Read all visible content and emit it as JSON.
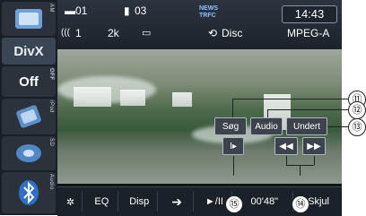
{
  "sidebar": {
    "sources": [
      {
        "label": "AM",
        "icon": "radio-icon"
      },
      {
        "label": "DivX",
        "icon": ""
      },
      {
        "label": "OFF",
        "text": "Off",
        "icon": ""
      },
      {
        "label": "iPod",
        "icon": "ipod-icon"
      },
      {
        "label": "SD",
        "icon": "sd-card-icon"
      },
      {
        "label": "Audio",
        "icon": "bluetooth-icon"
      }
    ]
  },
  "status": {
    "folder_number": "01",
    "file_number": "03",
    "channel": "1",
    "bitrate": "2k",
    "repeat_mode": "Disc",
    "format": "MPEG-A",
    "news_label": "NEWS",
    "traffic_label": "TRFC",
    "clock": "14:43"
  },
  "overlay": {
    "search_label": "Søg",
    "audio_label": "Audio",
    "subtitle_label": "Undert"
  },
  "bottom_bar": {
    "eq_label": "EQ",
    "disp_label": "Disp",
    "play_pause_label": "►/II",
    "elapsed_time": "00'48\"",
    "hide_label": "Skjul"
  },
  "callouts": {
    "c11": "⑪",
    "c12": "⑫",
    "c13": "⑬",
    "c14": "⑭",
    "c15": "⑮"
  }
}
